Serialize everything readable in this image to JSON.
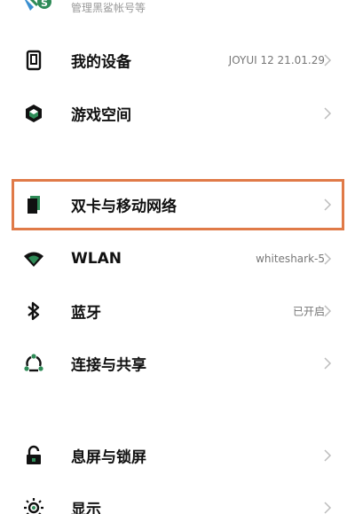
{
  "account": {
    "subtitle": "管理黑鲨帐号等"
  },
  "settings": [
    {
      "label": "我的设备",
      "value": "JOYUI 12 21.01.29",
      "icon": "phone-icon"
    },
    {
      "label": "游戏空间",
      "value": "",
      "icon": "game-cube-icon"
    },
    {
      "label": "双卡与移动网络",
      "value": "",
      "icon": "sim-card-icon"
    },
    {
      "label": "WLAN",
      "value": "whiteshark-5",
      "icon": "wifi-icon"
    },
    {
      "label": "蓝牙",
      "value": "已开启",
      "icon": "bluetooth-icon"
    },
    {
      "label": "连接与共享",
      "value": "",
      "icon": "share-icon"
    },
    {
      "label": "息屏与锁屏",
      "value": "",
      "icon": "lock-icon"
    },
    {
      "label": "显示",
      "value": "",
      "icon": "brightness-icon"
    }
  ],
  "colors": {
    "icon": "#111111",
    "accent_green": "#2e8b57",
    "highlight": "#e07a48",
    "chevron": "#bdbdbd"
  }
}
